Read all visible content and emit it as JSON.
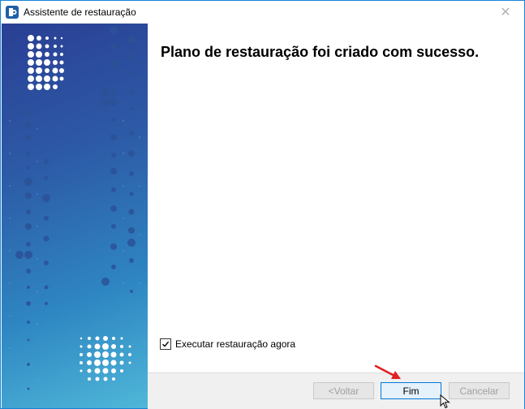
{
  "window": {
    "title": "Assistente de restauração",
    "close_glyph": "✕"
  },
  "main": {
    "heading": "Plano de restauração foi criado com sucesso.",
    "run_now": {
      "label": "Executar restauração agora",
      "checked": true
    }
  },
  "footer": {
    "back_label": "<Voltar",
    "finish_label": "Fim",
    "cancel_label": "Cancelar"
  },
  "colors": {
    "accent_border": "#1883d7",
    "side_gradient": [
      "#2a3f94",
      "#2e86c2",
      "#4fb7d8"
    ],
    "annotation_arrow": "#e02020"
  },
  "icons": [
    "app-icon",
    "close-icon",
    "check-icon",
    "cursor-icon",
    "annotation-arrow"
  ]
}
